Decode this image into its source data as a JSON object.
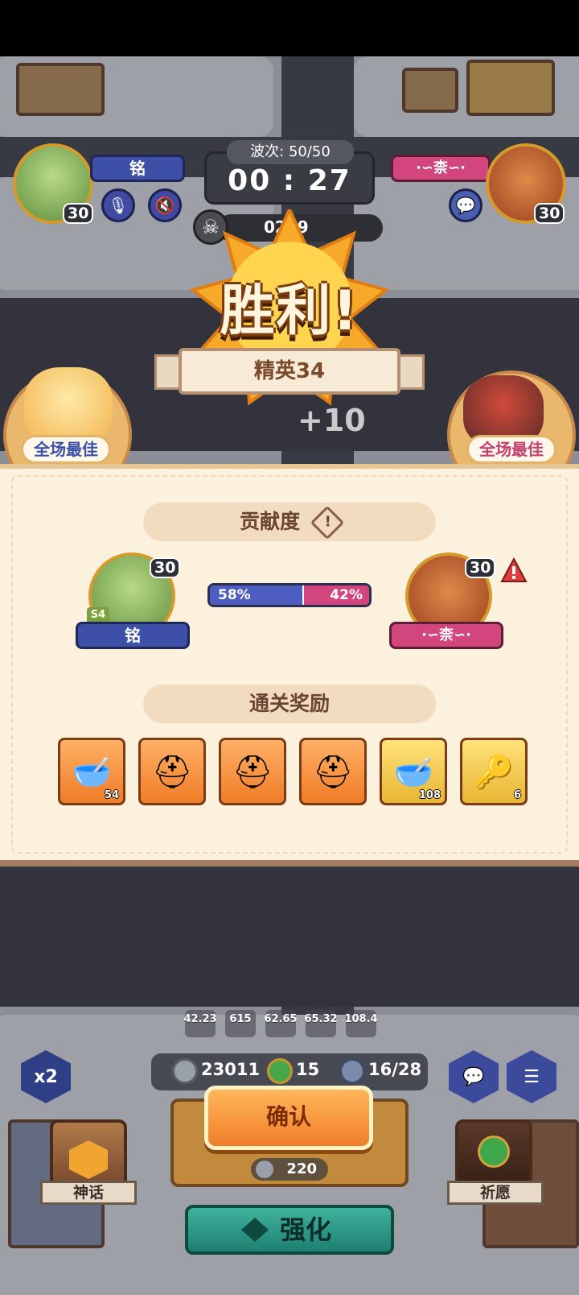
{
  "hud": {
    "wave_text": "波次: 50/50",
    "timer": "00 : 27",
    "kill_count": "0209",
    "player_left": {
      "name": "铭",
      "level": "30",
      "rank_badge": "S4"
    },
    "player_right": {
      "name": "·∽柰∽·",
      "level": "30"
    }
  },
  "result": {
    "title": "胜利!",
    "stage": "精英34",
    "bonus": "+10",
    "mvp_left": "全场最佳",
    "mvp_right": "全场最佳"
  },
  "contribution": {
    "header": "贡献度",
    "left": {
      "name": "铭",
      "level": "30",
      "rank_badge": "S4",
      "percent_label": "58%",
      "percent": 58
    },
    "right": {
      "name": "·∽柰∽·",
      "level": "30",
      "percent_label": "42%",
      "percent": 42
    }
  },
  "rewards": {
    "header": "通关奖励",
    "items": [
      {
        "icon": "golden-bowl-icon",
        "count": "54",
        "rarity": "orange"
      },
      {
        "icon": "blue-helmet-icon",
        "count": "",
        "rarity": "orange"
      },
      {
        "icon": "blue-helmet-icon",
        "count": "",
        "rarity": "orange"
      },
      {
        "icon": "blue-helmet-icon",
        "count": "",
        "rarity": "orange"
      },
      {
        "icon": "golden-bowl-icon",
        "count": "108",
        "rarity": "gold"
      },
      {
        "icon": "gold-key-icon",
        "count": "6",
        "rarity": "gold"
      }
    ]
  },
  "stats": [
    "42.23",
    "615",
    "62.65",
    "65.32",
    "108.4"
  ],
  "resources": {
    "coins": "23011",
    "clover": "15",
    "units": "16/28"
  },
  "buttons": {
    "speed": "x2",
    "confirm": "确认",
    "cost": "220",
    "enhance": "强化",
    "myth": "神话",
    "wish": "祈愿"
  },
  "colors": {
    "blue_team": "#4d5ec0",
    "pink_team": "#d2457d",
    "panel_bg": "#fbf1dc",
    "confirm": "#f07e2a",
    "enhance": "#1e7f70"
  }
}
